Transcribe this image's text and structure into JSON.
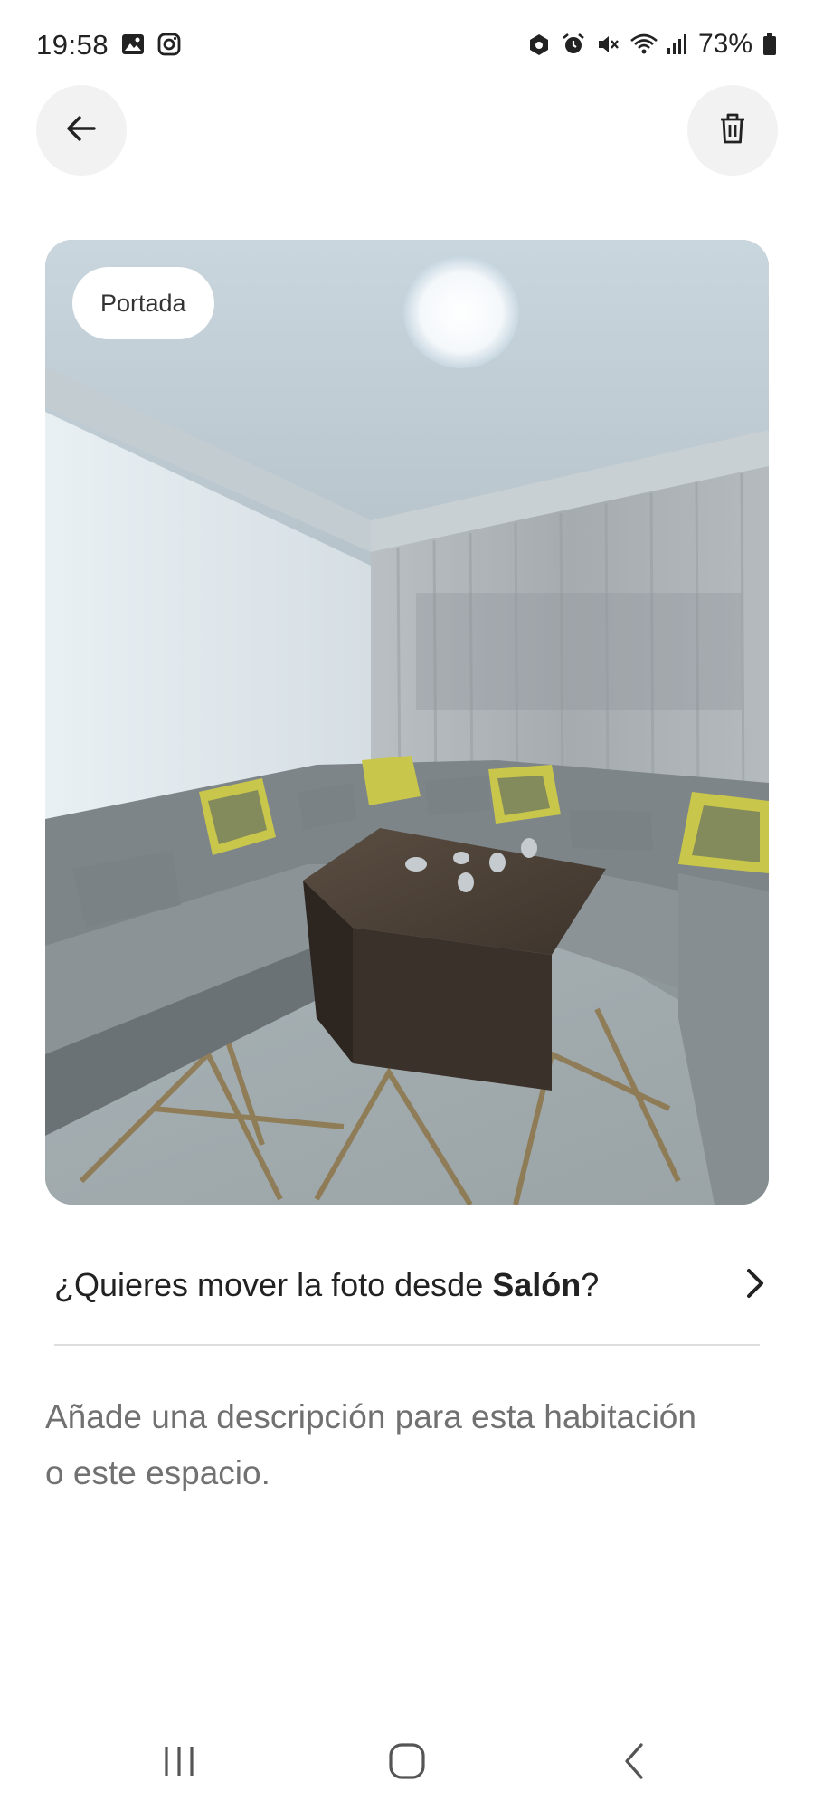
{
  "status_bar": {
    "time": "19:58",
    "battery": "73%",
    "left_icons": [
      "gallery-icon",
      "instagram-icon"
    ],
    "right_icons": [
      "data-saver-icon",
      "alarm-icon",
      "mute-icon",
      "wifi-icon",
      "signal-icon",
      "battery-icon"
    ]
  },
  "header": {
    "back_icon": "arrow-left-icon",
    "delete_icon": "trash-icon"
  },
  "photo": {
    "badge": "Portada"
  },
  "move_row": {
    "prefix": "¿Quieres mover la foto desde ",
    "room": "Salón",
    "suffix": "?",
    "icon": "chevron-right-icon"
  },
  "description": {
    "placeholder": "Añade una descripción para esta habitación o este espacio."
  },
  "nav_bar": {
    "items": [
      "recents-icon",
      "home-icon",
      "back-icon"
    ]
  }
}
